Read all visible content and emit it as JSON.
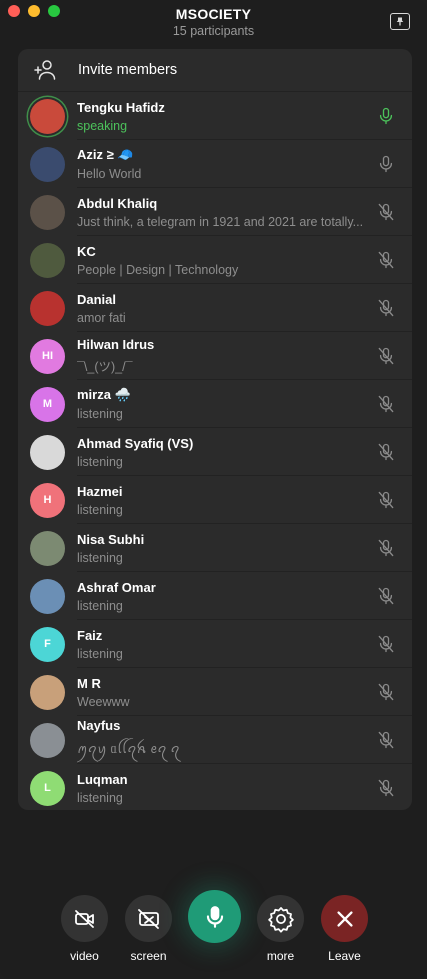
{
  "window": {
    "title": "MSOCIETY",
    "subtitle": "15 participants"
  },
  "invite": {
    "label": "Invite members"
  },
  "members": [
    {
      "name": "Tengku Hafidz",
      "status": "speaking",
      "initials": "",
      "avatar_color": "#c94a3b",
      "mic": "active"
    },
    {
      "name": "Aziz ≥ 🧢",
      "status": "Hello World",
      "initials": "",
      "avatar_color": "#3a4b6e",
      "mic": "on"
    },
    {
      "name": "Abdul Khaliq",
      "status": "Just think, a telegram in 1921 and 2021 are totally...",
      "initials": "",
      "avatar_color": "#5b5148",
      "mic": "muted"
    },
    {
      "name": "KC",
      "status": "People | Design | Technology",
      "initials": "",
      "avatar_color": "#4f5a3e",
      "mic": "muted"
    },
    {
      "name": "Danial",
      "status": "amor fati",
      "initials": "",
      "avatar_color": "#b8322f",
      "mic": "muted"
    },
    {
      "name": "Hilwan Idrus",
      "status": "¯\\_(ツ)_/¯",
      "initials": "HI",
      "avatar_color": "#e17ae0",
      "mic": "muted"
    },
    {
      "name": "mirza 🌧️",
      "status": "listening",
      "initials": "M",
      "avatar_color": "#d874e8",
      "mic": "muted"
    },
    {
      "name": "Ahmad Syafiq (VS)",
      "status": "listening",
      "initials": "",
      "avatar_color": "#d9d9d9",
      "mic": "muted"
    },
    {
      "name": "Hazmei",
      "status": "listening",
      "initials": "H",
      "avatar_color": "#f0727a",
      "mic": "muted"
    },
    {
      "name": "Nisa Subhi",
      "status": "listening",
      "initials": "",
      "avatar_color": "#7c8a72",
      "mic": "muted"
    },
    {
      "name": "Ashraf Omar",
      "status": "listening",
      "initials": "",
      "avatar_color": "#6b8fb5",
      "mic": "muted"
    },
    {
      "name": "Faiz",
      "status": "listening",
      "initials": "F",
      "avatar_color": "#4cd6d6",
      "mic": "muted"
    },
    {
      "name": "M R",
      "status": "Weewww",
      "initials": "",
      "avatar_color": "#c8a07a",
      "mic": "muted"
    },
    {
      "name": "Nayfus",
      "status": "ꪑꪖꪗ ᥲꪶꪶꪖꫝ ꫀꪖ ꪖ",
      "initials": "",
      "avatar_color": "#8a8f94",
      "mic": "muted"
    },
    {
      "name": "Luqman",
      "status": "listening",
      "initials": "L",
      "avatar_color": "#8fdc74",
      "mic": "muted"
    }
  ],
  "controls": {
    "video": "video",
    "screen": "screen",
    "more": "more",
    "leave": "Leave"
  },
  "colors": {
    "speaking": "#4cc25b",
    "mic_main": "#1f9b77",
    "leave": "#7a2424"
  }
}
